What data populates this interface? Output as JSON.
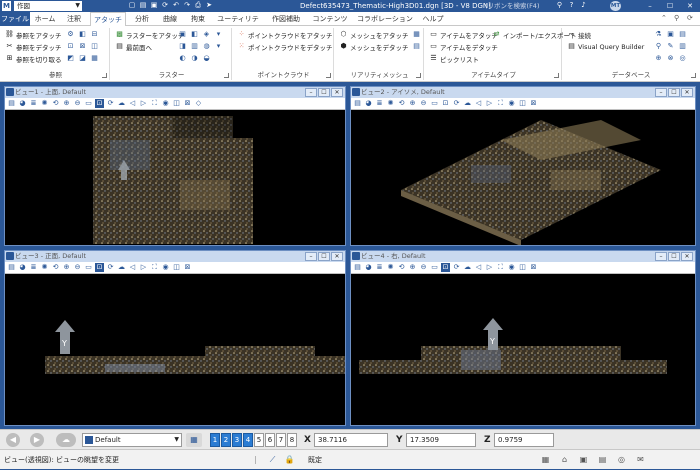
{
  "titlebar": {
    "logo": "M",
    "workspace": "作図",
    "title": "Defect635473_Thematic-High3D01.dgn [3D - V8 DGN]",
    "search_placeholder": "(リボンを検索(F4)",
    "user_initials": "MT",
    "qat_icons": [
      "new-icon",
      "open-icon",
      "save-icon",
      "sync-icon",
      "undo-icon",
      "redo-icon",
      "print-icon",
      "pointer-icon"
    ]
  },
  "tabs": [
    "ファイル",
    "ホーム",
    "注釈",
    "アタッチ",
    "分析",
    "曲線",
    "拘束",
    "ユーティリティ",
    "作図補助",
    "コンテンツ",
    "コラボレーション",
    "ヘルプ"
  ],
  "active_tab": "アタッチ",
  "ribbon": {
    "reference": {
      "label": "参照",
      "buttons": [
        "参照をアタッチ",
        "参照をデタッチ",
        "参照を切り取る"
      ]
    },
    "raster": {
      "label": "ラスター",
      "buttons": [
        "ラスターをアタッチ",
        "最前面へ"
      ]
    },
    "pointcloud": {
      "label": "ポイントクラウド",
      "buttons": [
        "ポイントクラウドをアタッチ",
        "ポイントクラウドをデタッチ"
      ]
    },
    "realitymesh": {
      "label": "リアリティメッシュ",
      "buttons": [
        "メッシュをアタッチ",
        "メッシュをデタッチ"
      ]
    },
    "itemtype": {
      "label": "アイテムタイプ",
      "buttons": [
        "アイテムをアタッチ",
        "アイテムをデタッチ",
        "ピックリスト",
        "インポート/エクスポート"
      ]
    },
    "database": {
      "label": "データベース",
      "buttons": [
        "接続",
        "Visual Query Builder"
      ]
    }
  },
  "views": [
    {
      "title": "ビュー1 - 上面, Default",
      "kind": "top"
    },
    {
      "title": "ビュー2 - アイソメ, Default",
      "kind": "iso"
    },
    {
      "title": "ビュー3 - 正面, Default",
      "kind": "front"
    },
    {
      "title": "ビュー4 - 右, Default",
      "kind": "right"
    }
  ],
  "bottombar": {
    "view_group": "Default",
    "view_numbers": [
      "1",
      "2",
      "3",
      "4",
      "5",
      "6",
      "7",
      "8"
    ],
    "active_views": [
      1,
      2,
      3,
      4
    ],
    "x_label": "X",
    "x_value": "38.7116",
    "y_label": "Y",
    "y_value": "17.3509",
    "z_label": "Z",
    "z_value": "0.9759"
  },
  "statusbar": {
    "message": "ビュー(透視図): ビューの眺望を変更",
    "lock_label": "既定"
  }
}
